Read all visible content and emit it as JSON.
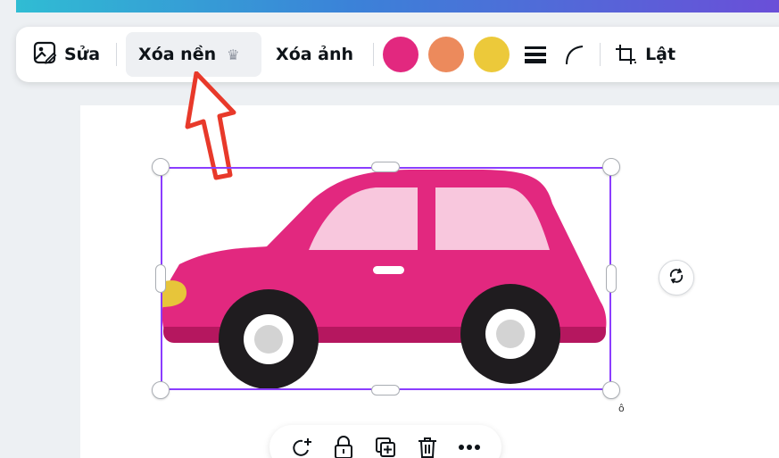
{
  "toolbar": {
    "edit_label": "Sửa",
    "remove_bg_label": "Xóa nền",
    "erase_label": "Xóa ảnh",
    "flip_label": "Lật",
    "crown_glyph": "♛",
    "swatches": [
      "#e2287f",
      "#ec8a5c",
      "#ecc93a"
    ]
  },
  "canvas": {
    "rotation_hint": "ô"
  },
  "colors": {
    "selection": "#8b3dff",
    "arrow": "#e8392a",
    "car_body": "#e2287f",
    "car_window": "#f8c7dd",
    "tire": "#1f1c1f",
    "hub": "#d3d3d3",
    "headlight": "#e7c53a"
  }
}
